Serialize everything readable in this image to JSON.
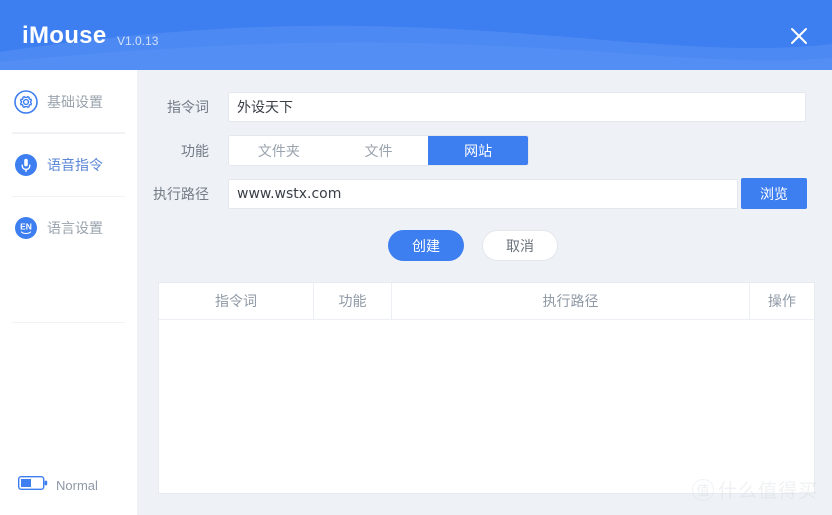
{
  "header": {
    "brand": "iMouse",
    "version": "V1.0.13",
    "close_icon": "close-icon",
    "bg_color": "#3d7ef0"
  },
  "sidebar": {
    "items": [
      {
        "label": "基础设置",
        "icon": "gear-icon",
        "active": false
      },
      {
        "label": "语音指令",
        "icon": "microphone-icon",
        "active": true
      },
      {
        "label": "语言设置",
        "icon": "en-language-icon",
        "active": false
      }
    ],
    "status": {
      "icon": "battery-icon",
      "label": "Normal"
    }
  },
  "form": {
    "command_word": {
      "label": "指令词",
      "value": "外设天下",
      "placeholder": ""
    },
    "function": {
      "label": "功能",
      "options": [
        "文件夹",
        "文件",
        "网站"
      ],
      "selected": "网站"
    },
    "exec_path": {
      "label": "执行路径",
      "value": "www.wstx.com",
      "placeholder": "",
      "browse_label": "浏览"
    },
    "actions": {
      "create_label": "创建",
      "cancel_label": "取消"
    }
  },
  "table": {
    "columns": [
      "指令词",
      "功能",
      "执行路径",
      "操作"
    ],
    "rows": []
  },
  "watermark": {
    "mark": "值",
    "text": "什么值得买"
  },
  "colors": {
    "accent": "#3d7ef0",
    "page_bg": "#eef1f5",
    "panel_bg": "#ffffff",
    "muted_text": "#9aa3ae"
  }
}
